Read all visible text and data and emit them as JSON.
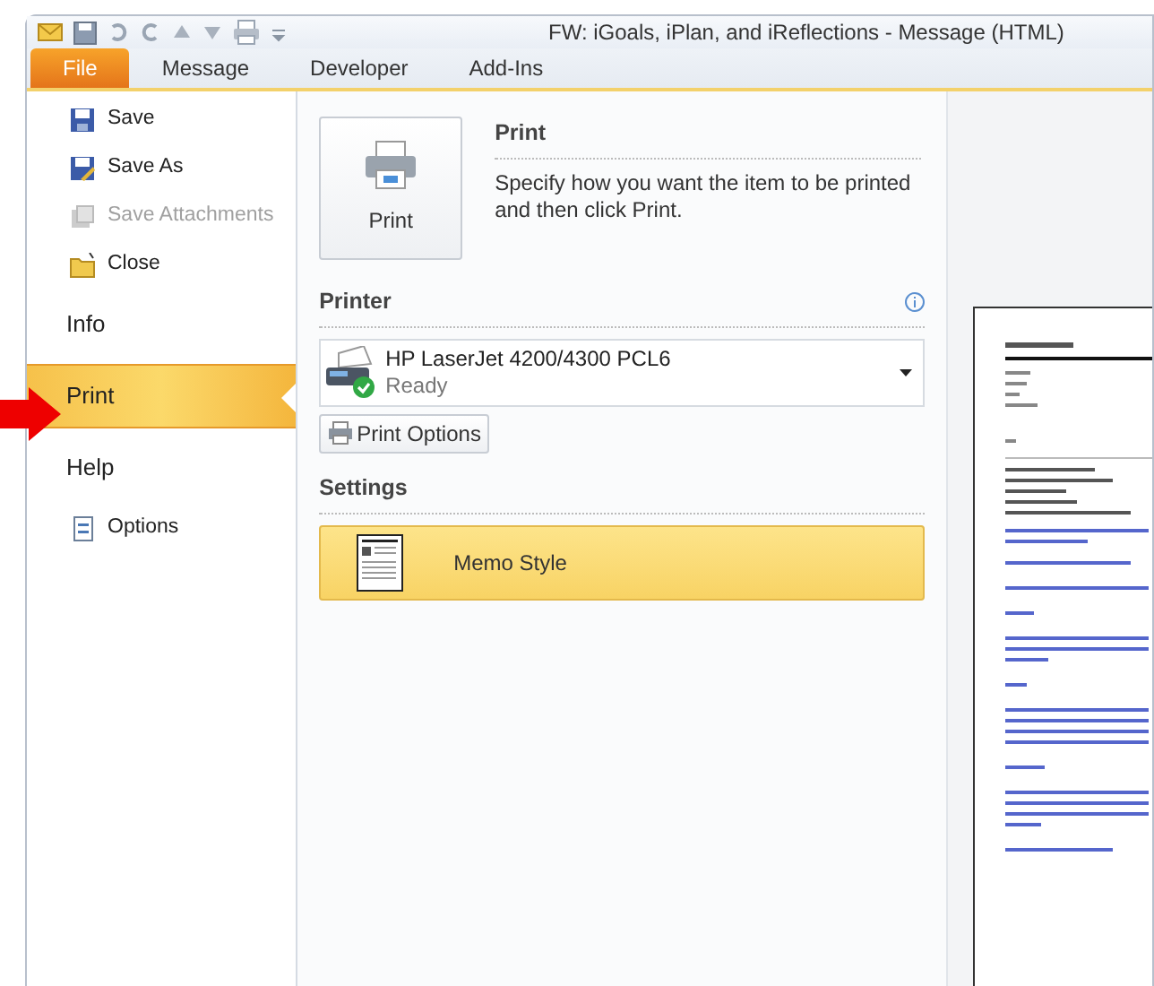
{
  "window": {
    "title": "FW: iGoals, iPlan, and iReflections  -  Message (HTML)"
  },
  "tabs": [
    {
      "label": "File",
      "selected": true
    },
    {
      "label": "Message",
      "selected": false
    },
    {
      "label": "Developer",
      "selected": false
    },
    {
      "label": "Add-Ins",
      "selected": false
    }
  ],
  "backstage_menu": [
    {
      "label": "Save",
      "kind": "command",
      "disabled": false
    },
    {
      "label": "Save As",
      "kind": "command",
      "disabled": false
    },
    {
      "label": "Save Attachments",
      "kind": "command",
      "disabled": true
    },
    {
      "label": "Close",
      "kind": "command",
      "disabled": false
    },
    {
      "label": "Info",
      "kind": "tab",
      "disabled": false,
      "selected": false
    },
    {
      "label": "Print",
      "kind": "tab",
      "disabled": false,
      "selected": true
    },
    {
      "label": "Help",
      "kind": "tab",
      "disabled": false,
      "selected": false
    },
    {
      "label": "Options",
      "kind": "command",
      "disabled": false
    }
  ],
  "print": {
    "button": "Print",
    "heading": "Print",
    "description": "Specify how you want the item to be printed and then click Print."
  },
  "printer": {
    "heading": "Printer",
    "name": "HP LaserJet 4200/4300 PCL6",
    "status": "Ready",
    "options_button": "Print Options"
  },
  "settings": {
    "heading": "Settings",
    "style": "Memo Style"
  }
}
